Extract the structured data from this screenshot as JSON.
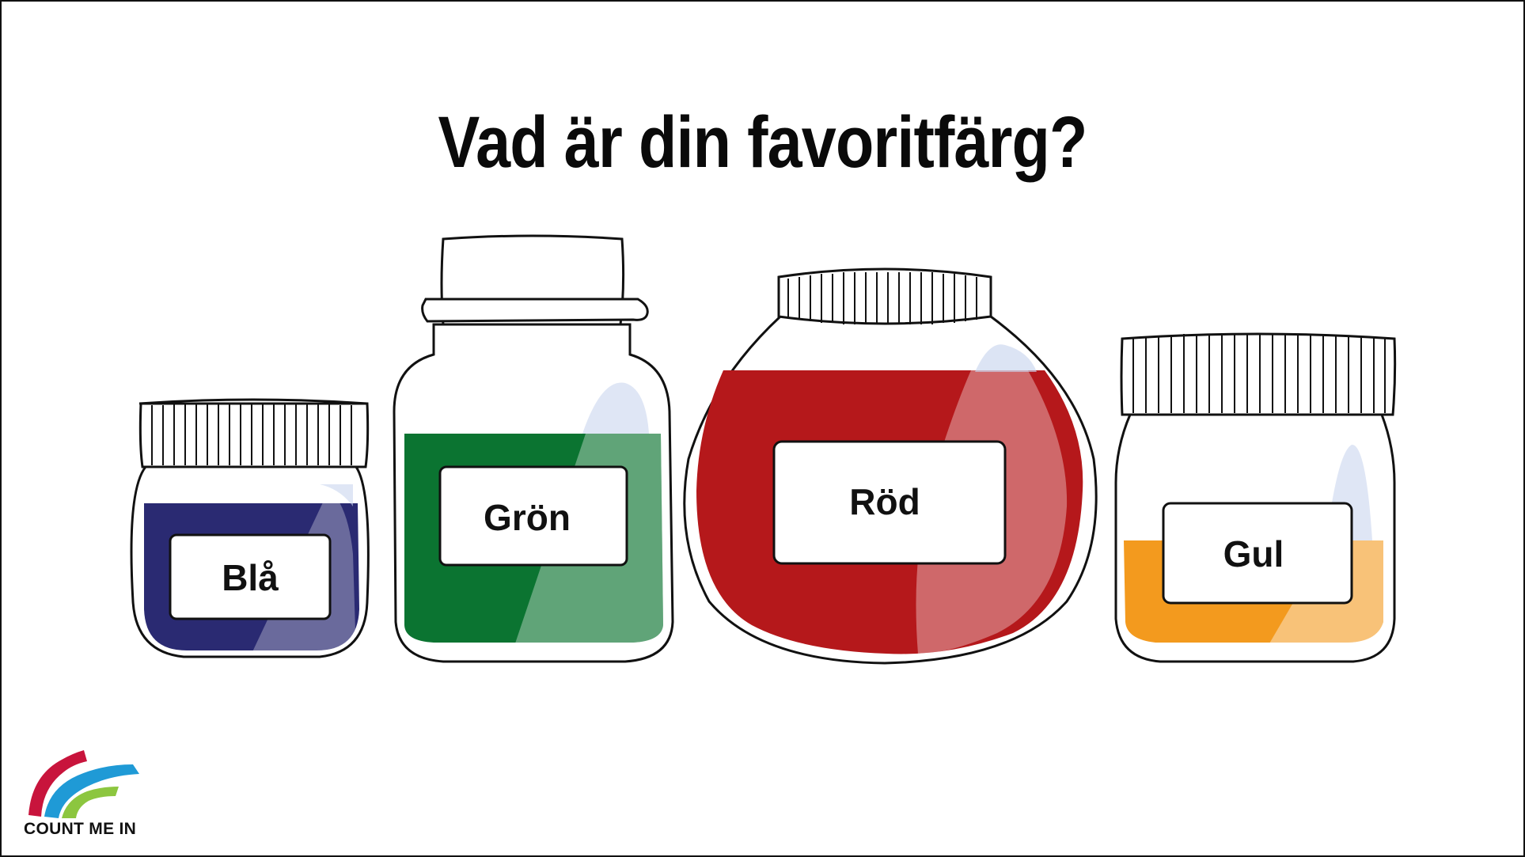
{
  "title": "Vad är din favoritfärg?",
  "jars": [
    {
      "label": "Blå",
      "color": "#2a2a72"
    },
    {
      "label": "Grön",
      "color": "#0b7431"
    },
    {
      "label": "Röd",
      "color": "#b5181b"
    },
    {
      "label": "Gul",
      "color": "#f39a1e"
    }
  ],
  "logo": {
    "text": "COUNT ME IN",
    "colors": [
      "#c8143c",
      "#1f9ad6",
      "#8cc63f"
    ]
  }
}
